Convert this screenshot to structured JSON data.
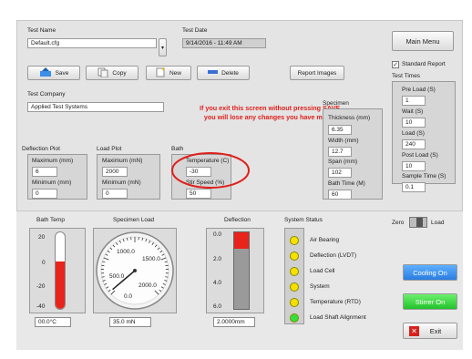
{
  "test": {
    "name_label": "Test Name",
    "name_value": "Default.cfg",
    "date_label": "Test Date",
    "date_value": "9/14/2016 - 11:49 AM"
  },
  "toolbar": {
    "save": "Save",
    "copy": "Copy",
    "new": "New",
    "delete": "Delete",
    "report_images": "Report Images",
    "main_menu": "Main Menu"
  },
  "company": {
    "label": "Test Company",
    "value": "Applied Test Systems"
  },
  "warning": "If you exit this screen without pressing SAVE you will lose any changes you have made.",
  "standard_report": {
    "label": "Standard Report",
    "checked": true
  },
  "test_times": {
    "title": "Test Times",
    "pre_load_label": "Pre Load (S)",
    "pre_load": "1",
    "wait_label": "Wait (S)",
    "wait": "10",
    "load_label": "Load (S)",
    "load": "240",
    "post_load_label": "Post Load (S)",
    "post_load": "10",
    "sample_time_label": "Sample Time (S)",
    "sample_time": "0.1"
  },
  "specimen": {
    "title": "Specimen",
    "thickness_label": "Thickness (mm)",
    "thickness": "6.35",
    "width_label": "Width (mm)",
    "width": "12.7",
    "span_label": "Span (mm)",
    "span": "102",
    "bath_time_label": "Bath Time (M)",
    "bath_time": "60"
  },
  "deflection_plot": {
    "title": "Deflection Plot",
    "max_label": "Maximum (mm)",
    "max": "6",
    "min_label": "Minimum (mm)",
    "min": "0"
  },
  "load_plot": {
    "title": "Load Plot",
    "max_label": "Maximum (mN)",
    "max": "2000",
    "min_label": "Minimum (mN)",
    "min": "0"
  },
  "bath": {
    "title": "Bath",
    "temp_label": "Temperature (C)",
    "temp": "-30",
    "stir_label": "Stir Speed (%)",
    "stir": "50"
  },
  "bath_temp": {
    "title": "Bath Temp",
    "ticks": [
      "20",
      "0",
      "-20",
      "-40"
    ],
    "level_fraction": 0.62,
    "readout": "00.0°C"
  },
  "specimen_load": {
    "title": "Specimen Load",
    "ticks": [
      "1000.0",
      "1500.0",
      "500.0",
      "2000.0",
      "0.0"
    ],
    "value": 35.0,
    "readout": "35.0 mN"
  },
  "deflection": {
    "title": "Deflection",
    "ticks": [
      "0.0",
      "2.0",
      "4.0",
      "6.0"
    ],
    "level_fraction": 0.22,
    "readout": "2.0000mm"
  },
  "system_status": {
    "title": "System Status",
    "items": [
      {
        "label": "Air Bearing",
        "color": "#f5e000"
      },
      {
        "label": "Deflection (LVDT)",
        "color": "#f5e000"
      },
      {
        "label": "Load Cell",
        "color": "#f5e000"
      },
      {
        "label": "System",
        "color": "#f5e000"
      },
      {
        "label": "Temperature (RTD)",
        "color": "#f5e000"
      },
      {
        "label": "Load Shaft Alignment",
        "color": "#33e03a"
      }
    ]
  },
  "zero_load": {
    "zero": "Zero",
    "load": "Load"
  },
  "controls": {
    "cooling_on": "Cooling On",
    "stirrer_on": "Stirrer On",
    "exit": "Exit"
  },
  "colors": {
    "accent_blue": "#3a8fe8",
    "accent_green": "#2fd13a",
    "warning_red": "#e0201c",
    "thermo_red": "#e8231c"
  }
}
